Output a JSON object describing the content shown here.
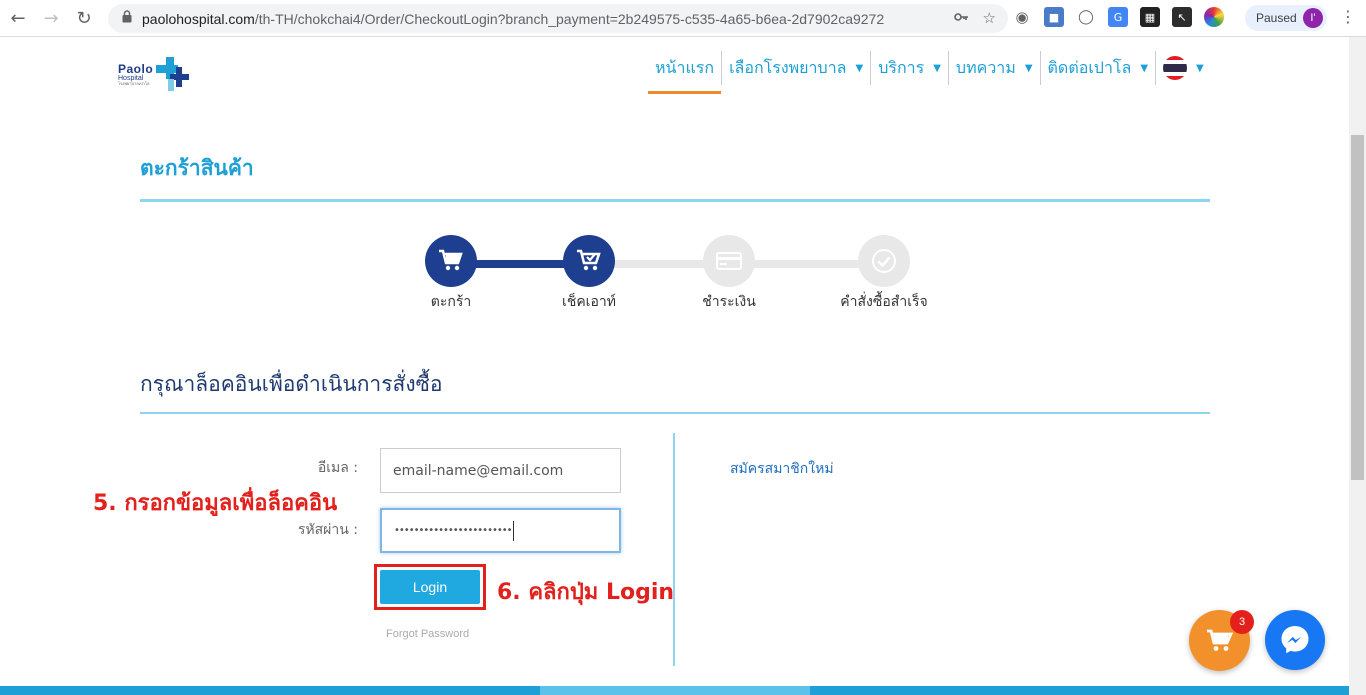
{
  "browser": {
    "url_host": "paolohospital.com",
    "url_path": "/th-TH/chokchai4/Order/CheckoutLogin?branch_payment=2b249575-c535-4a65-b6ea-2d7902ca9272",
    "profile_label": "Paused",
    "profile_initial": "I'"
  },
  "header": {
    "logo_line1": "Paolo",
    "logo_line2": "Hospital",
    "logo_line3": "โรงพยาบาลเปาโล",
    "nav": [
      {
        "label": "หน้าแรก",
        "active": true
      },
      {
        "label": "เลือกโรงพยาบาล"
      },
      {
        "label": "บริการ"
      },
      {
        "label": "บทความ"
      },
      {
        "label": "ติดต่อเปาโล"
      }
    ]
  },
  "cart": {
    "title": "ตะกร้าสินค้า",
    "steps": [
      {
        "label": "ตะกร้า",
        "icon": "cart-icon",
        "done": true
      },
      {
        "label": "เช็คเอาท์",
        "icon": "cart-check-icon",
        "done": true
      },
      {
        "label": "ชำระเงิน",
        "icon": "credit-card-icon",
        "done": false
      },
      {
        "label": "คำสั่งซื้อสำเร็จ",
        "icon": "check-circle-icon",
        "done": false
      }
    ]
  },
  "login": {
    "title": "กรุณาล็อคอินเพื่อดำเนินการสั่งซื้อ",
    "email_label": "อีเมล :",
    "email_value": "email-name@email.com",
    "password_label": "รหัสผ่าน :",
    "password_value": "••••••••••••••••••••••••",
    "login_button": "Login",
    "forgot_password": "Forgot Password",
    "register_link": "สมัครสมาชิกใหม่"
  },
  "annotations": {
    "step5": "5. กรอกข้อมูลเพื่อล็อคอิน",
    "step6": "6. คลิกปุ่ม Login"
  },
  "floating": {
    "cart_count": "3"
  },
  "colors": {
    "brand_blue": "#1ea0d7",
    "navy": "#1e3f8f",
    "accent_orange": "#f08a2c",
    "annotation_red": "#e3201b"
  }
}
